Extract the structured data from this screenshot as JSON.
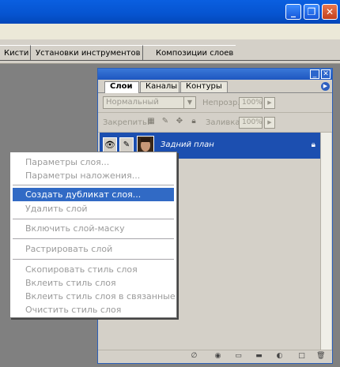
{
  "window_controls": {
    "minimize": "_",
    "maximize": "❐",
    "close": "✕"
  },
  "top_tabs": [
    "Кисти",
    "Установки инструментов",
    "Композиции слоев"
  ],
  "panel": {
    "tabs": [
      "Слои",
      "Каналы",
      "Контуры"
    ],
    "blend_mode": "Нормальный",
    "opacity_label": "Непрозр.:",
    "opacity_value": "100%",
    "lock_label": "Закрепить:",
    "fill_label": "Заливка:",
    "fill_value": "100%",
    "layer_name": "Задний план"
  },
  "context_menu": {
    "items": [
      "Параметры слоя...",
      "Параметры наложения...",
      "Создать дубликат слоя...",
      "Удалить слой",
      "Включить слой-маску",
      "Растрировать слой",
      "Скопировать стиль слоя",
      "Вклеить стиль слоя",
      "Вклеить стиль слоя в связанные",
      "Очистить стиль слоя"
    ],
    "highlighted_index": 2
  },
  "colors": {
    "accent": "#316ac5",
    "title": "#0654d0",
    "panel_bg": "#d4d0c8"
  }
}
